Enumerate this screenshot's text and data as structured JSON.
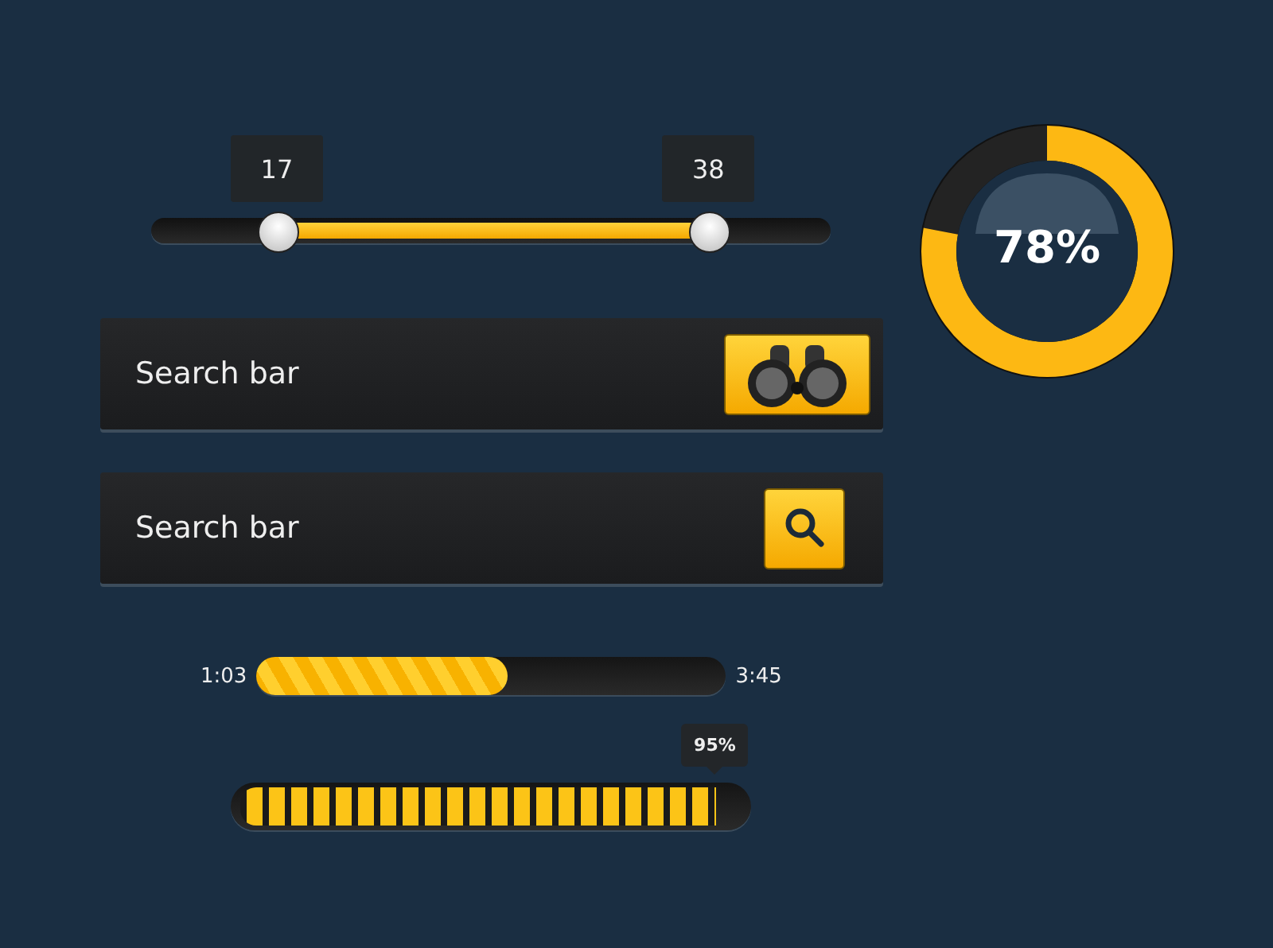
{
  "range_slider": {
    "low": {
      "label": "17",
      "level": 0.185
    },
    "high": {
      "label": "38",
      "level": 0.82
    }
  },
  "search_bars": [
    {
      "placeholder": "Search bar",
      "kind": "binoculars"
    },
    {
      "placeholder": "Search bar",
      "kind": "magnifier"
    }
  ],
  "media_progress": {
    "elapsed": "1:03",
    "total": "3:45",
    "level": 0.535
  },
  "segmented_progress": {
    "tooltip": "95%",
    "level": 0.95
  },
  "donut": {
    "label": "78%"
  }
}
